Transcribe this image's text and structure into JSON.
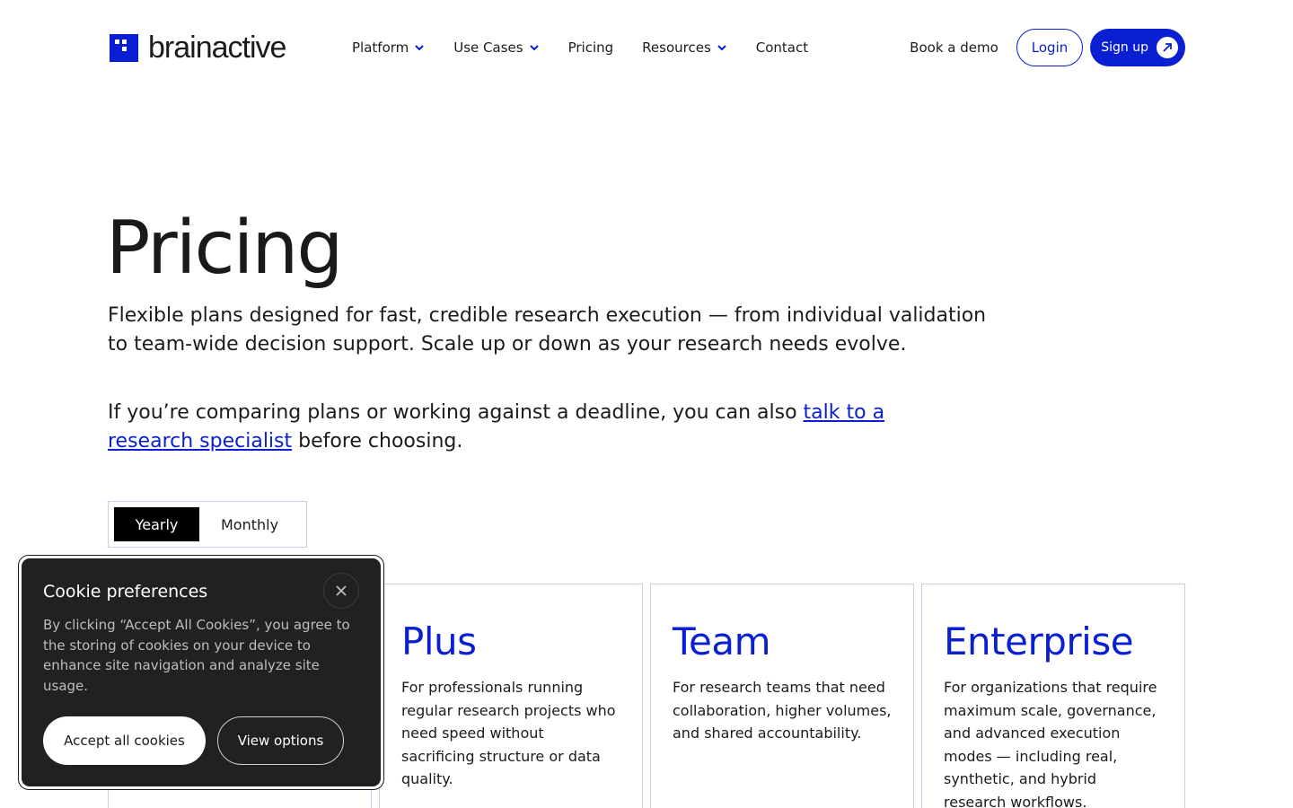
{
  "brand": {
    "name": "brainactive",
    "color": "#0a1ed2"
  },
  "nav": {
    "items": [
      {
        "label": "Platform",
        "has_dropdown": true
      },
      {
        "label": "Use Cases",
        "has_dropdown": true
      },
      {
        "label": "Pricing",
        "has_dropdown": false
      },
      {
        "label": "Resources",
        "has_dropdown": true
      },
      {
        "label": "Contact",
        "has_dropdown": false
      }
    ],
    "book_demo": "Book a demo",
    "login": "Login",
    "signup": "Sign up"
  },
  "hero": {
    "title": "Pricing",
    "lead": "Flexible plans designed for fast, credible research execution — from individual validation to team-wide decision support. Scale up or down as your research needs evolve.",
    "lead2_before": "If you’re comparing plans or working against a deadline, you can also ",
    "lead2_link": "talk to a research specialist",
    "lead2_after": " before choosing."
  },
  "billing_toggle": {
    "options": [
      "Yearly",
      "Monthly"
    ],
    "selected": "Yearly"
  },
  "plans": [
    {
      "name": "Plus",
      "description": "For professionals running regular research projects who need speed without sacrificing structure or data quality."
    },
    {
      "name": "Team",
      "description": "For research teams that need collaboration, higher volumes, and shared accountability."
    },
    {
      "name": "Enterprise",
      "description": "For organizations that require maximum scale, governance, and advanced execution modes — including real, synthetic, and hybrid research workflows."
    }
  ],
  "cookie": {
    "title": "Cookie preferences",
    "text": "By clicking “Accept All Cookies”, you agree to the storing of cookies on your device to enhance site navigation and analyze site usage.",
    "accept": "Accept all cookies",
    "view": "View options"
  },
  "icons": {
    "chevron": "chevron-down-icon",
    "signup_arrow": "arrow-up-right-icon",
    "close": "close-icon"
  }
}
